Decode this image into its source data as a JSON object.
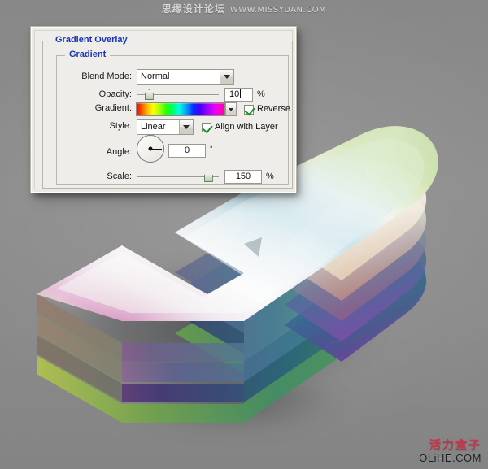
{
  "watermarks": {
    "top_cn": "思缘设计论坛",
    "top_en": "WWW.MISSYUAN.COM",
    "bottom_cn": "活力盒子",
    "bottom_en": "OLiHE.COM"
  },
  "dialog": {
    "outer_group_title": "Gradient Overlay",
    "inner_group_title": "Gradient",
    "accent_color": "#1935b6",
    "rows": {
      "blend_mode": {
        "label": "Blend Mode:",
        "value": "Normal",
        "icon": "chevron-down-icon"
      },
      "opacity": {
        "label": "Opacity:",
        "value": "10",
        "unit": "%",
        "slider_percent": 10
      },
      "gradient": {
        "label": "Gradient:",
        "preset": "spectrum",
        "icon": "chevron-down-icon"
      },
      "reverse": {
        "label": "Reverse",
        "checked": true
      },
      "style": {
        "label": "Style:",
        "value": "Linear",
        "icon": "chevron-down-icon"
      },
      "align_with_layer": {
        "label": "Align with Layer",
        "checked": true
      },
      "angle": {
        "label": "Angle:",
        "value": "0",
        "unit": "°",
        "dial_degrees": 0
      },
      "scale": {
        "label": "Scale:",
        "value": "150",
        "unit": "%",
        "slider_percent": 92
      }
    }
  },
  "scene": {
    "object_name": "isometric-layered-glass-horseshoe",
    "background_color": "#8c8c8c"
  }
}
